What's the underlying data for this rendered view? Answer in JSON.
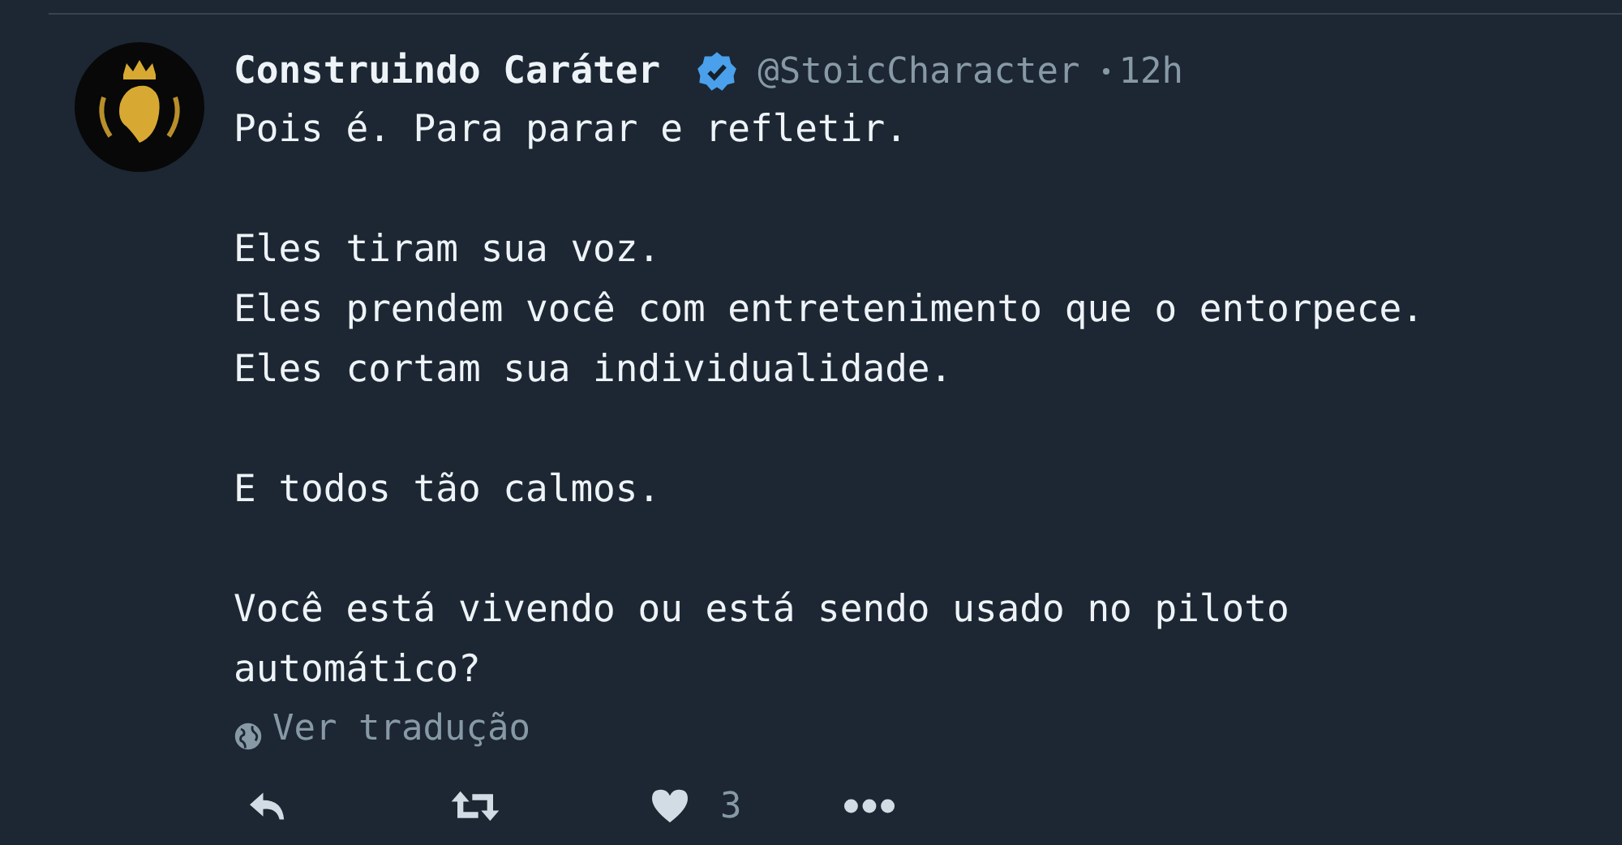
{
  "tweet": {
    "author": {
      "name": "Construindo Caráter",
      "verified": true,
      "handle": "@StoicCharacter",
      "time": "12h"
    },
    "paragraphs": [
      [
        "Pois é. Para parar e refletir."
      ],
      [
        "Eles tiram sua voz.",
        "Eles prendem você com entretenimento que o entorpece.",
        "Eles cortam sua individualidade."
      ],
      [
        "E todos tão calmos."
      ],
      [
        "Você está vivendo ou está sendo usado no piloto automático?"
      ]
    ],
    "translate": "Ver tradução",
    "actions": [
      {
        "kind": "reply"
      },
      {
        "kind": "retweet"
      },
      {
        "kind": "like",
        "count": "3"
      },
      {
        "kind": "more"
      }
    ]
  }
}
